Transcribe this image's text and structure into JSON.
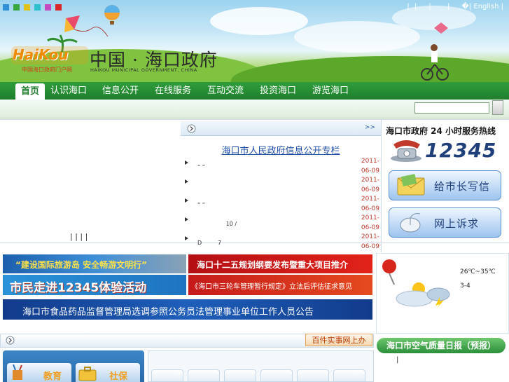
{
  "header": {
    "logo_text": "HaiKou",
    "logo_sub": "中国海口政府门户网",
    "site_title": "中国 · 海口政府",
    "site_subtitle": "HAIKOU MUNICIPAL GOVERNMENT, CHINA",
    "top_links": [
      "|",
      "|",
      "|",
      "|",
      "�|",
      "English",
      "|"
    ],
    "swatch_colors": [
      "#2e8fd6",
      "#3aa840",
      "#e0c21a",
      "#2fbfcf",
      "#c448c0",
      "#d8262a"
    ]
  },
  "nav": {
    "items": [
      "首页",
      "认识海口",
      "信息公开",
      "在线服务",
      "互动交流",
      "投资海口",
      "游览海口"
    ]
  },
  "search": {
    "value": "",
    "button_label": ""
  },
  "news": {
    "more": ">>",
    "title": "海口市人民政府信息公开专栏",
    "rows": [
      {
        "text": "“ ”",
        "date": "2011-06-09"
      },
      {
        "text": "",
        "date": "2011-06-09"
      },
      {
        "text": "“ ”",
        "date": "2011-06-09"
      },
      {
        "text": "                10 /",
        "date": "2011-06-09"
      },
      {
        "text": "D         7",
        "date": "2011-06-09"
      }
    ]
  },
  "left_links": "|   |   |   |",
  "hotline": {
    "title": "海口市政府 24 小时服务热线",
    "number": "12345"
  },
  "right_buttons": {
    "mayor_mail": "给市长写信",
    "online_complaint": "网上诉求"
  },
  "banners": {
    "b1": "“建设国际旅游岛  安全畅游文明行”",
    "b2": "海口十二五规划纲要发布暨重大项目推介",
    "b3": "市民走进12345体验活动",
    "b4": "《海口市三轮车管理暂行规定》立法后评估征求意见",
    "b5": "海口市食品药品监督管理局选调参照公务员法管理事业单位工作人员公告"
  },
  "weather": {
    "temp": "26℃~35℃",
    "wind": "3-4"
  },
  "bottom": {
    "shishi": "百件实事网上办",
    "air_quality": "海口市空气质量日报（预报）",
    "air_line": "|",
    "tile_labels": [
      "教育",
      "社保"
    ]
  }
}
